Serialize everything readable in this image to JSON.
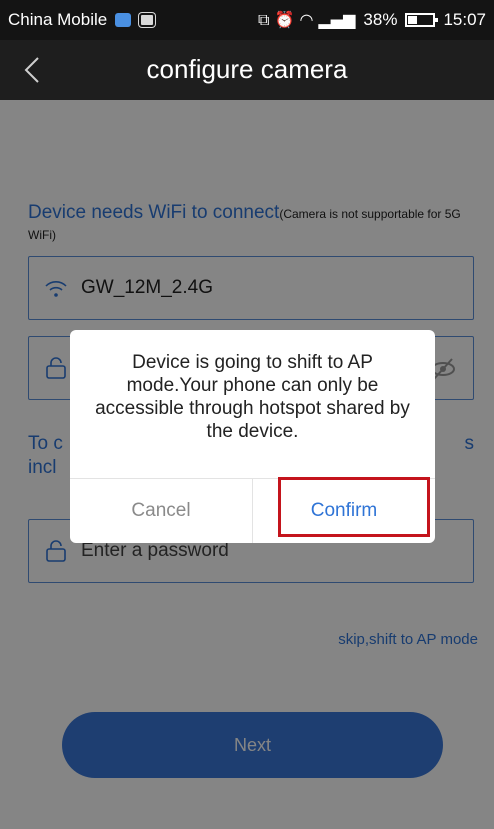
{
  "status_bar": {
    "carrier": "China Mobile",
    "signal_glyphs": "⧉ ⏰ ◠ ▂▄▆",
    "battery_percent": "38%",
    "battery_level": 0.38,
    "time": "15:07"
  },
  "nav": {
    "title": "configure camera"
  },
  "form": {
    "wifi_label": "Device needs WiFi to connect",
    "wifi_note": "(Camera is not supportable for 5G WiFi)",
    "ssid_value": "GW_12M_2.4G",
    "hint_left": "To c\nincl",
    "hint_right": "s",
    "device_password_placeholder": "Enter a password",
    "skip_link": "skip,shift to AP mode",
    "next_label": "Next"
  },
  "dialog": {
    "message": "Device is going to shift to AP mode.Your phone can only be accessible through hotspot shared by the device.",
    "cancel_label": "Cancel",
    "confirm_label": "Confirm"
  },
  "colors": {
    "accent": "#2f74d6",
    "highlight": "#c4141c",
    "topbar": "#1e1e1e"
  }
}
